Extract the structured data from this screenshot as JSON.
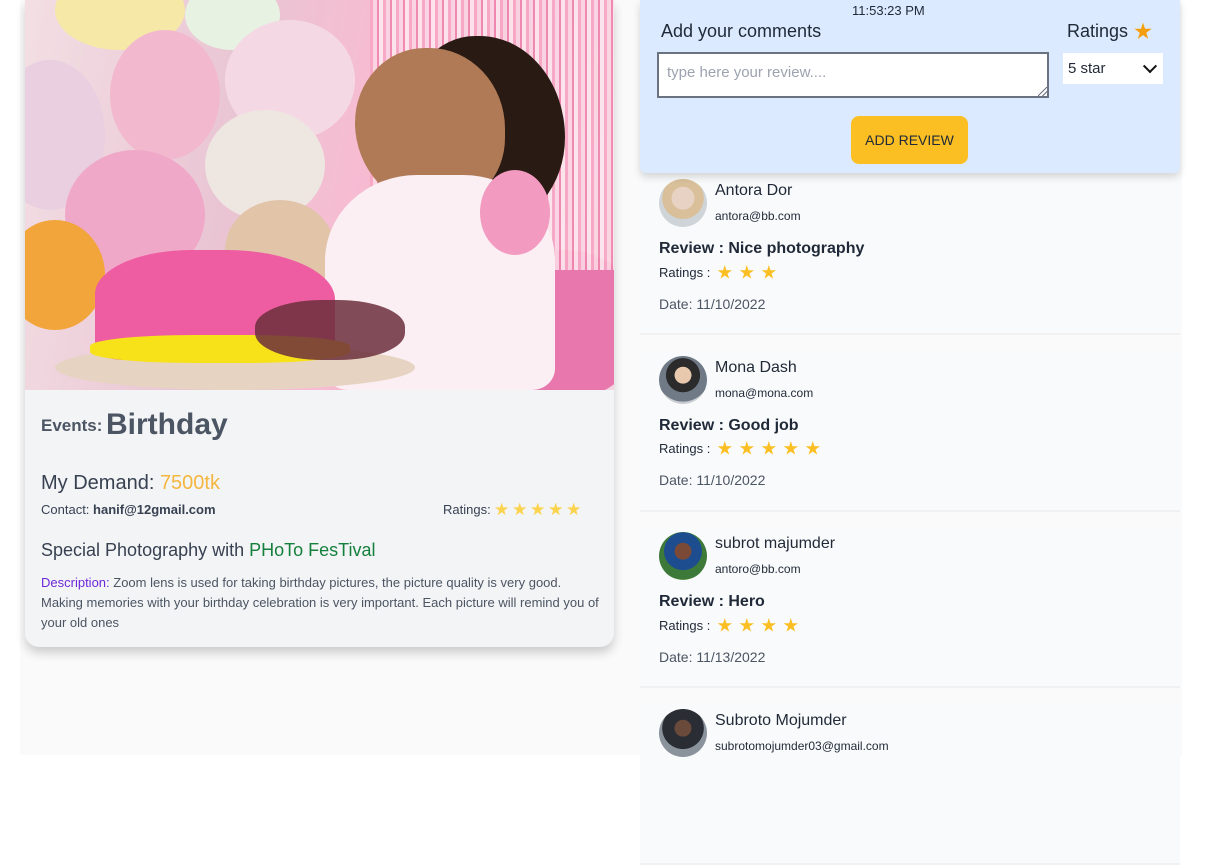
{
  "event": {
    "events_label": "Events:",
    "events_value": "Birthday",
    "demand_label": "My Demand:",
    "demand_price": "7500tk",
    "contact_label": "Contact:",
    "contact_value": "hanif@12gmail.com",
    "ratings_label": "Ratings:",
    "ratings_count": 5,
    "special_text": "Special Photography with",
    "special_brand": "PHoTo FesTival",
    "description_label": "Description:",
    "description_text": " Zoom lens is used for taking birthday pictures, the picture quality is very good. Making memories with your birthday celebration is very important. Each picture will remind you of your old ones"
  },
  "form": {
    "clock": "11:53:23 PM",
    "title": "Add your comments",
    "ratings_title": "Ratings",
    "placeholder": "type here your review....",
    "select_value": "5 star",
    "button_label": "ADD REVIEW"
  },
  "colors": {
    "accent_yellow": "#fbbf24",
    "brand_green": "#15803d",
    "description_purple": "#6d28d9",
    "panel_blue": "#dbeafe"
  },
  "reviews": [
    {
      "name": "Antora Dor",
      "email": "antora@bb.com",
      "review": "Review : Nice photography",
      "ratings_label": "Ratings :",
      "stars": 3,
      "date": "Date: 11/10/2022"
    },
    {
      "name": "Mona Dash",
      "email": "mona@mona.com",
      "review": "Review : Good job",
      "ratings_label": "Ratings :",
      "stars": 5,
      "date": "Date: 11/10/2022"
    },
    {
      "name": "subrot majumder",
      "email": "antoro@bb.com",
      "review": "Review : Hero",
      "ratings_label": "Ratings :",
      "stars": 4,
      "date": "Date: 11/13/2022"
    },
    {
      "name": "Subroto Mojumder",
      "email": "subrotomojumder03@gmail.com"
    }
  ]
}
